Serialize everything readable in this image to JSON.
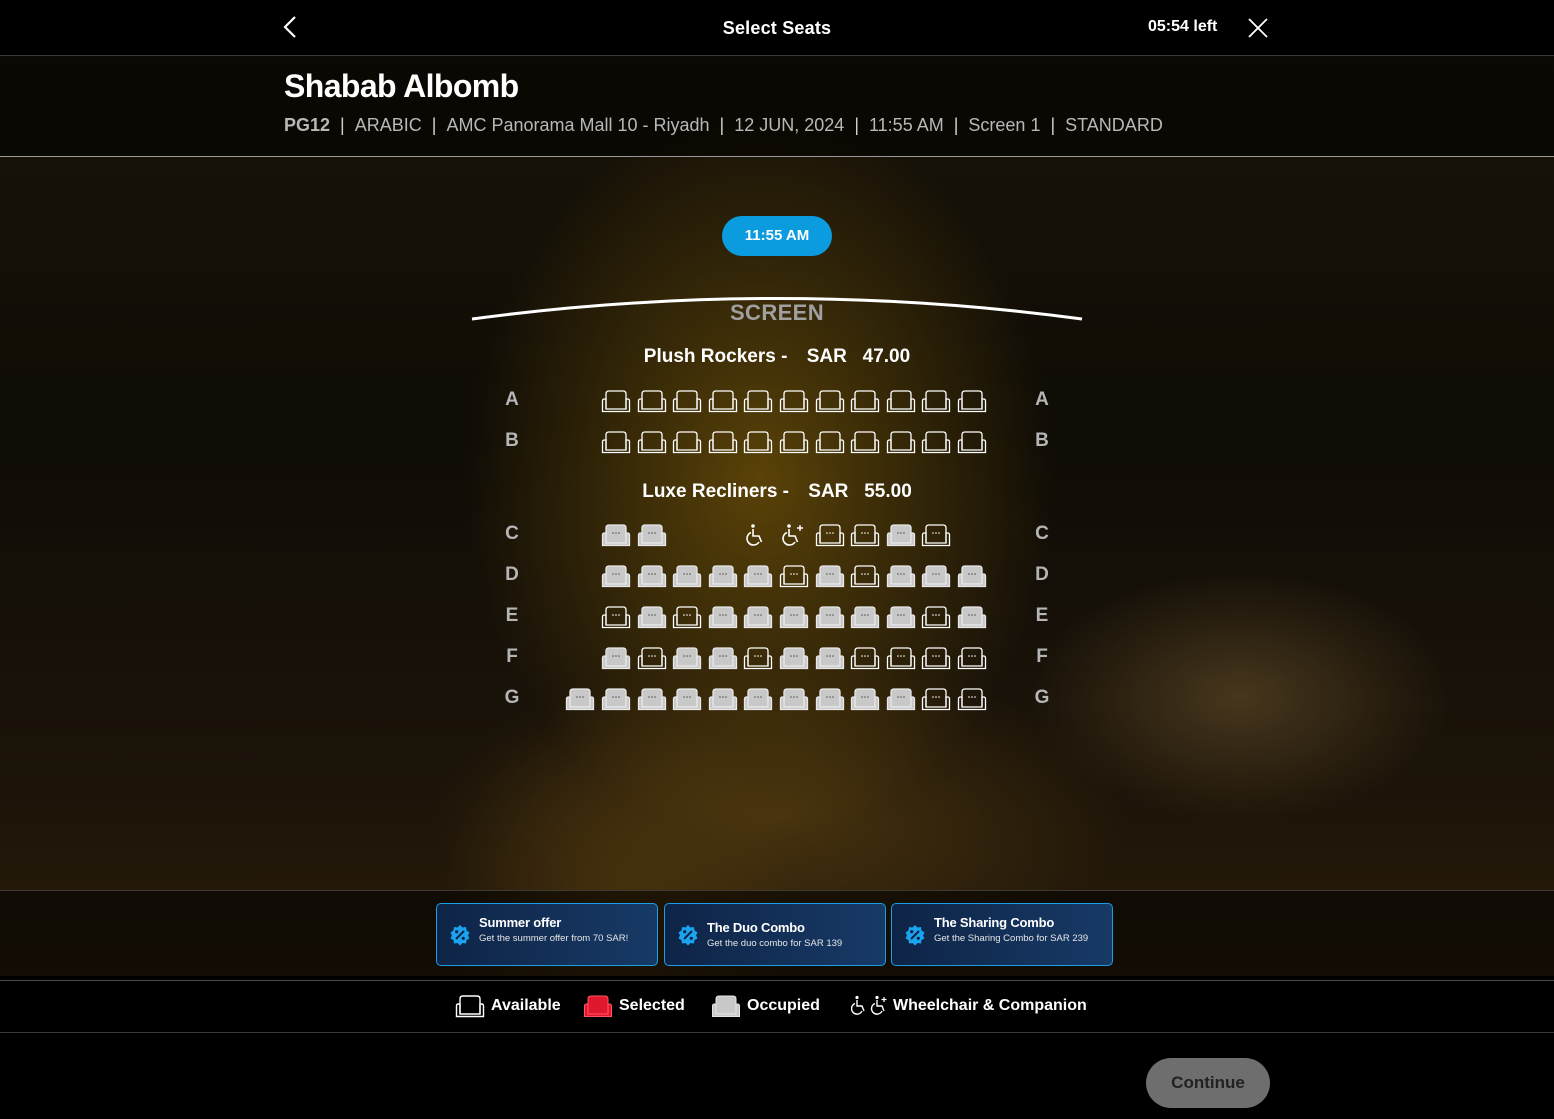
{
  "header": {
    "title": "Select Seats",
    "timer": "05:54 left"
  },
  "movie": {
    "title": "Shabab Albomb",
    "rating": "PG12",
    "language": "ARABIC",
    "cinema": "AMC Panorama Mall 10 - Riyadh",
    "date": "12 JUN, 2024",
    "time": "11:55 AM",
    "screen": "Screen 1",
    "format": "STANDARD"
  },
  "showtime_pill": "11:55 AM",
  "screen_label": "SCREEN",
  "sections": [
    {
      "name": "Plush Rockers -",
      "price": "SAR   47.00",
      "rows": [
        {
          "label": "A",
          "seats": [
            "available",
            "available",
            "available",
            "available",
            "available",
            "available",
            "available",
            "available",
            "available",
            "available",
            "available"
          ]
        },
        {
          "label": "B",
          "seats": [
            "available",
            "available",
            "available",
            "available",
            "available",
            "available",
            "available",
            "available",
            "available",
            "available",
            "available"
          ]
        }
      ]
    },
    {
      "name": "Luxe Recliners -",
      "price": "SAR   55.00",
      "rows": [
        {
          "label": "C",
          "seats": [
            "occupied",
            "occupied",
            "gap",
            "gap",
            "wheelchair",
            "companion",
            "available",
            "available",
            "occupied",
            "available"
          ]
        },
        {
          "label": "D",
          "seats": [
            "occupied",
            "occupied",
            "occupied",
            "occupied",
            "occupied",
            "available",
            "occupied",
            "available",
            "occupied",
            "occupied",
            "occupied"
          ]
        },
        {
          "label": "E",
          "seats": [
            "available",
            "occupied",
            "available",
            "occupied",
            "occupied",
            "occupied",
            "occupied",
            "occupied",
            "occupied",
            "available",
            "occupied"
          ]
        },
        {
          "label": "F",
          "seats": [
            "occupied",
            "available",
            "occupied",
            "occupied",
            "available",
            "occupied",
            "occupied",
            "available",
            "available",
            "available",
            "available"
          ]
        },
        {
          "label": "G",
          "seats": [
            "occupied",
            "occupied",
            "occupied",
            "occupied",
            "occupied",
            "occupied",
            "occupied",
            "occupied",
            "occupied",
            "occupied",
            "available",
            "available"
          ]
        }
      ]
    }
  ],
  "offers": [
    {
      "title": "Summer offer",
      "description": "Get the summer offer from 70 SAR!",
      "icon": "percent-badge-icon"
    },
    {
      "title": "The Duo Combo",
      "description": "Get the duo combo for SAR 139",
      "icon": "percent-badge-icon"
    },
    {
      "title": "The Sharing Combo",
      "description": "Get the Sharing Combo for SAR 239",
      "icon": "percent-badge-icon"
    }
  ],
  "legend": {
    "available": "Available",
    "selected": "Selected",
    "occupied": "Occupied",
    "wheelchair": "Wheelchair & Companion"
  },
  "colors": {
    "accent": "#0b9ce0",
    "selected": "#e0182d",
    "occupied": "#c8c8c8",
    "offer_border": "#1a9ee8"
  },
  "continue_label": "Continue"
}
